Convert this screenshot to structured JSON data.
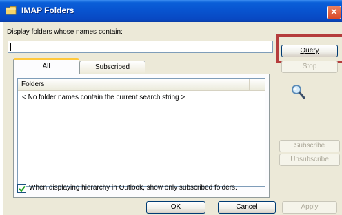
{
  "window": {
    "title": "IMAP Folders",
    "close_label": "×"
  },
  "filter": {
    "label": "Display folders whose names contain:",
    "value": ""
  },
  "buttons": {
    "query": "Query",
    "stop": "Stop",
    "subscribe": "Subscribe",
    "unsubscribe": "Unsubscribe",
    "ok": "OK",
    "cancel": "Cancel",
    "apply": "Apply"
  },
  "tabs": [
    {
      "label": "All",
      "selected": true
    },
    {
      "label": "Subscribed",
      "selected": false
    }
  ],
  "list": {
    "columns": [
      "Folders"
    ],
    "empty_message": "< No folder names contain the current search string >"
  },
  "options": {
    "subscribed_only_label": "When displaying hierarchy in Outlook, show only subscribed folders.",
    "subscribed_only_checked": true
  },
  "colors": {
    "titlebar": "#0853cf",
    "dialog_background": "#ece9d8",
    "highlight_box": "#b53c3c",
    "active_tab_accent": "#ffc83c"
  },
  "icons": {
    "title": "folder-icon",
    "search": "magnifier-icon",
    "check": "checkmark-icon"
  }
}
